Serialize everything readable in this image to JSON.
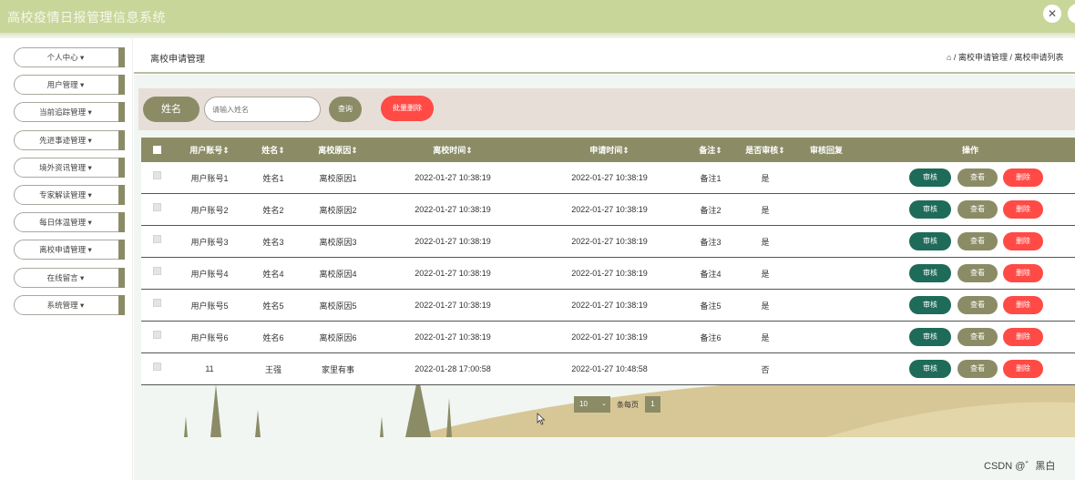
{
  "app": {
    "title": "高校疫情日报管理信息系统"
  },
  "sidebar": {
    "items": [
      {
        "label": "个人中心 ▾"
      },
      {
        "label": "用户管理 ▾"
      },
      {
        "label": "当前追踪管理 ▾"
      },
      {
        "label": "先进事迹管理 ▾"
      },
      {
        "label": "境外资讯管理 ▾"
      },
      {
        "label": "专家解读管理 ▾"
      },
      {
        "label": "每日体温管理 ▾"
      },
      {
        "label": "离校申请管理 ▾"
      },
      {
        "label": "在线留言 ▾"
      },
      {
        "label": "系统管理 ▾"
      }
    ]
  },
  "header": {
    "title": "离校申请管理",
    "breadcrumb": "⌂ / 离校申请管理 / 离校申请列表"
  },
  "search": {
    "name_label": "姓名",
    "placeholder": "请输入姓名",
    "query_label": "查询",
    "batch_delete_label": "批量删除"
  },
  "table": {
    "columns": [
      "用户账号⇕",
      "姓名⇕",
      "离校原因⇕",
      "离校时间⇕",
      "申请时间⇕",
      "备注⇕",
      "是否审核⇕",
      "审核回复",
      "操作"
    ],
    "rows": [
      {
        "account": "用户账号1",
        "name": "姓名1",
        "reason": "离校原因1",
        "leave_time": "2022-01-27 10:38:19",
        "apply_time": "2022-01-27 10:38:19",
        "note": "备注1",
        "audited": "是"
      },
      {
        "account": "用户账号2",
        "name": "姓名2",
        "reason": "离校原因2",
        "leave_time": "2022-01-27 10:38:19",
        "apply_time": "2022-01-27 10:38:19",
        "note": "备注2",
        "audited": "是"
      },
      {
        "account": "用户账号3",
        "name": "姓名3",
        "reason": "离校原因3",
        "leave_time": "2022-01-27 10:38:19",
        "apply_time": "2022-01-27 10:38:19",
        "note": "备注3",
        "audited": "是"
      },
      {
        "account": "用户账号4",
        "name": "姓名4",
        "reason": "离校原因4",
        "leave_time": "2022-01-27 10:38:19",
        "apply_time": "2022-01-27 10:38:19",
        "note": "备注4",
        "audited": "是"
      },
      {
        "account": "用户账号5",
        "name": "姓名5",
        "reason": "离校原因5",
        "leave_time": "2022-01-27 10:38:19",
        "apply_time": "2022-01-27 10:38:19",
        "note": "备注5",
        "audited": "是"
      },
      {
        "account": "用户账号6",
        "name": "姓名6",
        "reason": "离校原因6",
        "leave_time": "2022-01-27 10:38:19",
        "apply_time": "2022-01-27 10:38:19",
        "note": "备注6",
        "audited": "是"
      },
      {
        "account": "11",
        "name": "王强",
        "reason": "家里有事",
        "leave_time": "2022-01-28 17:00:58",
        "apply_time": "2022-01-27 10:48:58",
        "note": "",
        "audited": "否"
      }
    ],
    "actions": {
      "audit": "审核",
      "view": "查看",
      "delete": "删除"
    }
  },
  "pagination": {
    "page_size": "10",
    "per_page_text": "条每页",
    "page": "1"
  },
  "watermark": "CSDN @゛黑白",
  "colors": {
    "topbar": "#c9d69a",
    "primary": "#8b8c66",
    "audit": "#1e6b5a",
    "danger": "#ff4a45",
    "search_bg": "#e7ded8"
  }
}
